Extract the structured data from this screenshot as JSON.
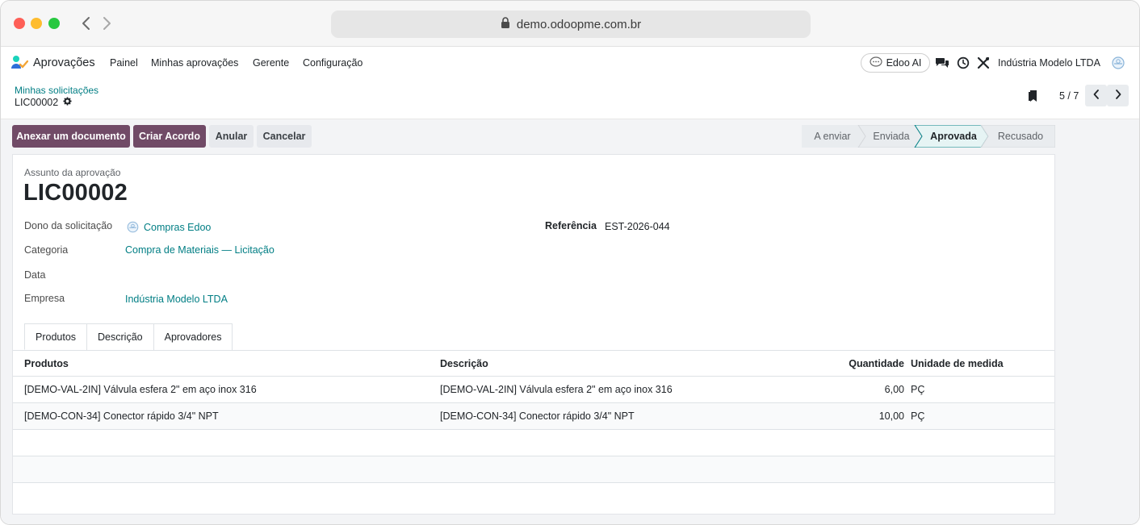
{
  "browser": {
    "url": "demo.odoopme.com.br"
  },
  "navbar": {
    "app_name": "Aprovações",
    "menu": [
      "Painel",
      "Minhas aprovações",
      "Gerente",
      "Configuração"
    ],
    "ai_label": "Edoo AI",
    "company": "Indústria Modelo LTDA"
  },
  "control": {
    "breadcrumb": "Minhas solicitações",
    "record": "LIC00002",
    "pager": "5 / 7"
  },
  "actions": {
    "attach": "Anexar um documento",
    "create_agreement": "Criar Acordo",
    "void": "Anular",
    "cancel": "Cancelar"
  },
  "status": {
    "stages": [
      "A enviar",
      "Enviada",
      "Aprovada",
      "Recusado"
    ],
    "active": "Aprovada"
  },
  "form": {
    "subject_caption": "Assunto da aprovação",
    "subject": "LIC00002",
    "owner_label": "Dono da solicitação",
    "owner": "Compras Edoo",
    "reference_label": "Referência",
    "reference": "EST-2026-044",
    "category_label": "Categoria",
    "category": "Compra de Materiais — Licitação",
    "date_label": "Data",
    "date": "",
    "company_label": "Empresa",
    "company": "Indústria Modelo LTDA"
  },
  "tabs": [
    "Produtos",
    "Descrição",
    "Aprovadores"
  ],
  "table": {
    "headers": [
      "Produtos",
      "Descrição",
      "Quantidade",
      "Unidade de medida"
    ],
    "rows": [
      [
        "[DEMO-VAL-2IN] Válvula esfera 2\" em aço inox 316",
        "[DEMO-VAL-2IN] Válvula esfera 2\" em aço inox 316",
        "6,00",
        "PÇ"
      ],
      [
        "[DEMO-CON-34] Conector rápido 3/4\" NPT",
        "[DEMO-CON-34] Conector rápido 3/4\" NPT",
        "10,00",
        "PÇ"
      ]
    ]
  },
  "colors": {
    "primary": "#714b67",
    "link": "#017e84",
    "active_stage": "#e6f4f4"
  }
}
